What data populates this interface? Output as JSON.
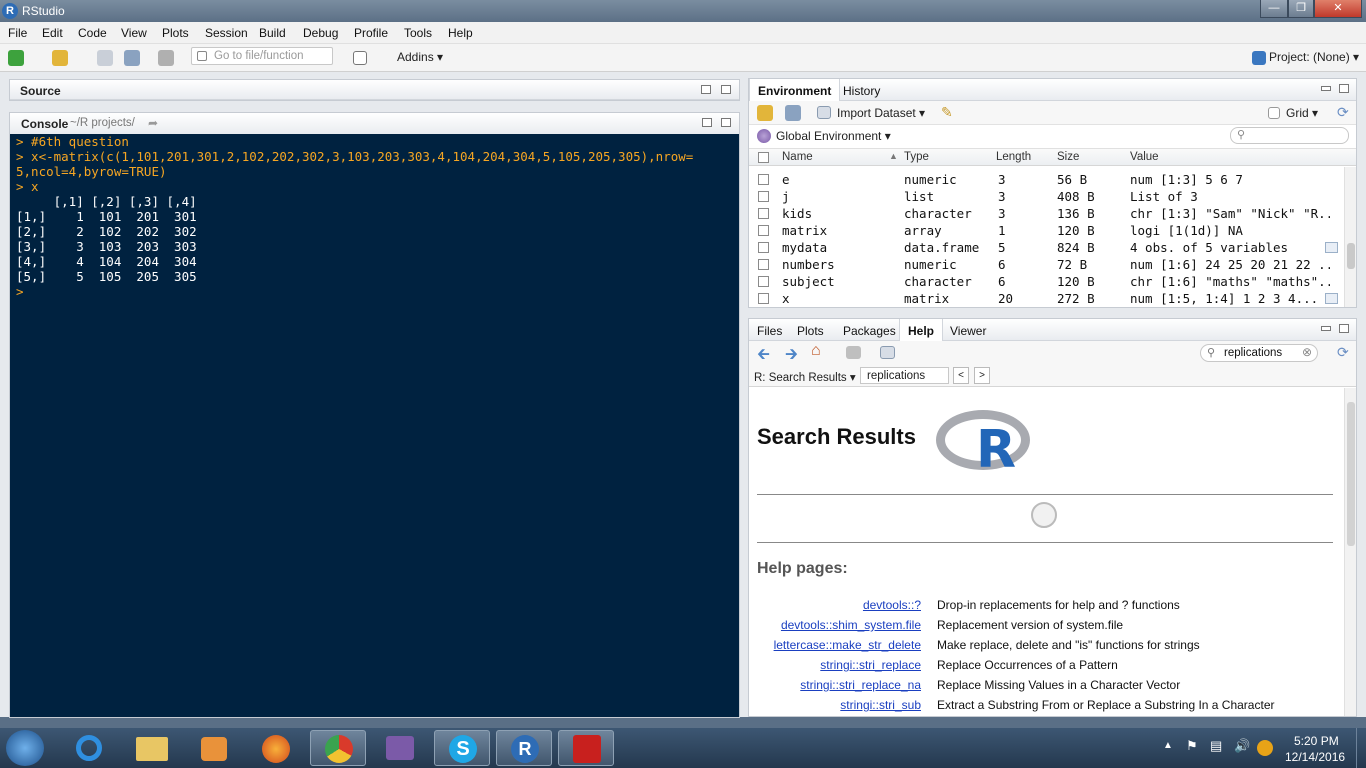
{
  "window": {
    "title": "RStudio"
  },
  "menu": [
    "File",
    "Edit",
    "Code",
    "View",
    "Plots",
    "Session",
    "Build",
    "Debug",
    "Profile",
    "Tools",
    "Help"
  ],
  "toolbar": {
    "goto_placeholder": "Go to file/function",
    "addins": "Addins",
    "project": "Project: (None)"
  },
  "source": {
    "label": "Source"
  },
  "console": {
    "label": "Console",
    "path": "~/R projects/",
    "lines": [
      {
        "text": "> #6th question",
        "type": "cmd"
      },
      {
        "text": "> x<-matrix(c(1,101,201,301,2,102,202,302,3,103,203,303,4,104,204,304,5,105,205,305),nrow=",
        "type": "cmd"
      },
      {
        "text": "5,ncol=4,byrow=TRUE)",
        "type": "cmd"
      },
      {
        "text": "> x",
        "type": "cmd"
      },
      {
        "text": "     [,1] [,2] [,3] [,4]",
        "type": "out"
      },
      {
        "text": "[1,]    1  101  201  301",
        "type": "out"
      },
      {
        "text": "[2,]    2  102  202  302",
        "type": "out"
      },
      {
        "text": "[3,]    3  103  203  303",
        "type": "out"
      },
      {
        "text": "[4,]    4  104  204  304",
        "type": "out"
      },
      {
        "text": "[5,]    5  105  205  305",
        "type": "out"
      },
      {
        "text": "> ",
        "type": "cmd"
      }
    ]
  },
  "environment": {
    "tabs": [
      "Environment",
      "History"
    ],
    "import_dataset": "Import Dataset",
    "grid": "Grid",
    "scope": "Global Environment",
    "columns": [
      "Name",
      "Type",
      "Length",
      "Size",
      "Value"
    ],
    "rows": [
      {
        "name": "e",
        "type": "numeric",
        "length": "3",
        "size": "56 B",
        "value": "num [1:3] 5 6 7"
      },
      {
        "name": "j",
        "type": "list",
        "length": "3",
        "size": "408 B",
        "value": "List of 3"
      },
      {
        "name": "kids",
        "type": "character",
        "length": "3",
        "size": "136 B",
        "value": "chr [1:3] \"Sam\" \"Nick\" \"R..."
      },
      {
        "name": "matrix",
        "type": "array",
        "length": "1",
        "size": "120 B",
        "value": "logi [1(1d)] NA"
      },
      {
        "name": "mydata",
        "type": "data.frame",
        "length": "5",
        "size": "824 B",
        "value": "4 obs. of 5 variables"
      },
      {
        "name": "numbers",
        "type": "numeric",
        "length": "6",
        "size": "72 B",
        "value": "num [1:6] 24 25 20 21 22 ..."
      },
      {
        "name": "subject",
        "type": "character",
        "length": "6",
        "size": "120 B",
        "value": "chr [1:6] \"maths\" \"maths\"..."
      },
      {
        "name": "x",
        "type": "matrix",
        "length": "20",
        "size": "272 B",
        "value": "num [1:5, 1:4] 1 2 3 4..."
      }
    ]
  },
  "files": {
    "tabs": [
      "Files",
      "Plots",
      "Packages",
      "Help",
      "Viewer"
    ],
    "search_value": "replications",
    "nav_label": "R: Search Results",
    "nav_search": "replications",
    "help_title": "Search Results",
    "help_section": "Help pages:",
    "help_pages": [
      {
        "link": "devtools::?",
        "desc": "Drop-in replacements for help and ? functions"
      },
      {
        "link": "devtools::shim_system.file",
        "desc": "Replacement version of system.file"
      },
      {
        "link": "lettercase::make_str_delete",
        "desc": "Make replace, delete and \"is\" functions for strings"
      },
      {
        "link": "stringi::stri_replace",
        "desc": "Replace Occurrences of a Pattern"
      },
      {
        "link": "stringi::stri_replace_na",
        "desc": "Replace Missing Values in a Character Vector"
      },
      {
        "link": "stringi::stri_sub",
        "desc": "Extract a Substring From or Replace a Substring In a Character"
      }
    ]
  },
  "taskbar": {
    "time": "5:20 PM",
    "date": "12/14/2016"
  },
  "colors": {
    "console_bg": "#002240",
    "console_cmd": "#f6a623",
    "link": "#1a3fc0"
  }
}
